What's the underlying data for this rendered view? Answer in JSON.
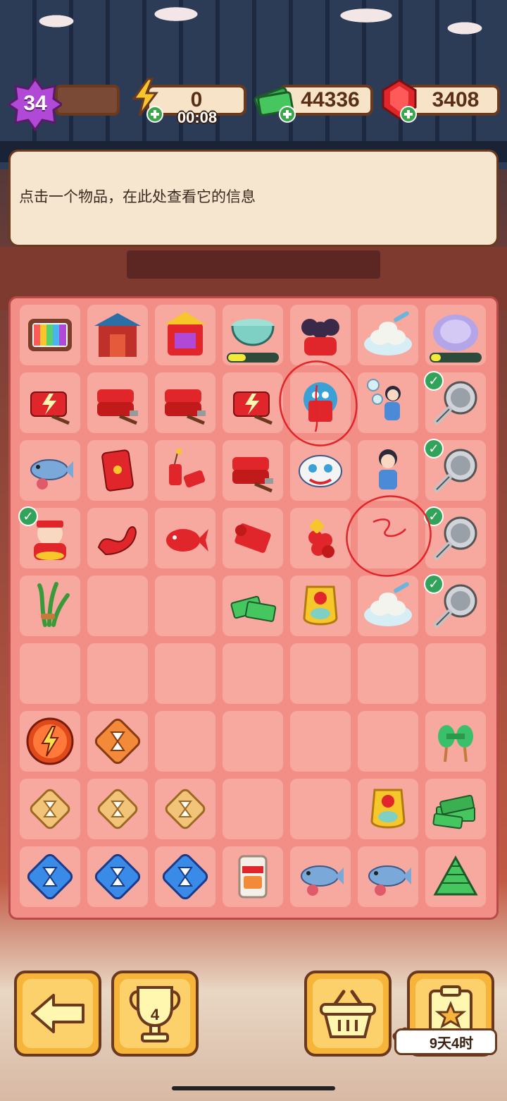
{
  "hud": {
    "level": "34",
    "energy": "0",
    "energy_timer": "00:08",
    "cash": "44336",
    "gems": "3408"
  },
  "info_panel": {
    "text": "点击一个物品，在此处查看它的信息"
  },
  "board": {
    "rows": 9,
    "cols": 7,
    "cells": [
      [
        "tv-icon",
        "gate-icon",
        "golden-shrine-icon",
        "pot-icon",
        "dancers-icon",
        "dumplings-icon",
        "plate-icon"
      ],
      [
        "energy-chest-icon",
        "firecracker-box-icon",
        "firecracker-box-icon",
        "energy-chest-icon",
        "lion-dance-icon",
        "juggler-girl-icon",
        "strainer-icon"
      ],
      [
        "fish-icon",
        "red-envelope-icon",
        "firecrackers-icon",
        "firecracker-box-icon",
        "lion-head-icon",
        "girl-icon",
        "strainer-icon"
      ],
      [
        "god-of-wealth-icon",
        "red-dragon-icon",
        "red-fish-icon",
        "red-scroll-icon",
        "firecracker-bundle-icon",
        "",
        "strainer-icon"
      ],
      [
        "greens-icon",
        "",
        "",
        "cash-stack-icon",
        "golden-charm-icon",
        "dumplings-icon",
        "strainer-icon"
      ],
      [
        "",
        "",
        "",
        "",
        "",
        "",
        ""
      ],
      [
        "energy-orb-icon",
        "hourglass-orange-icon",
        "",
        "",
        "",
        "",
        "green-rattle-icon"
      ],
      [
        "hourglass-gold-icon",
        "hourglass-gold-icon",
        "hourglass-gold-icon",
        "",
        "",
        "golden-charm-icon",
        "cash-pile-icon"
      ],
      [
        "hourglass-blue-icon",
        "hourglass-blue-icon",
        "hourglass-blue-icon",
        "snack-bag-icon",
        "fish-icon",
        "fish-icon",
        "cash-heap-icon"
      ]
    ]
  },
  "bottom": {
    "trophy_count": "4",
    "event_timer": "9天4时"
  },
  "colors": {
    "board": "#f28e86",
    "cell": "#f7a89f",
    "button": "#f6b43a",
    "outline": "#6b3a1e"
  }
}
